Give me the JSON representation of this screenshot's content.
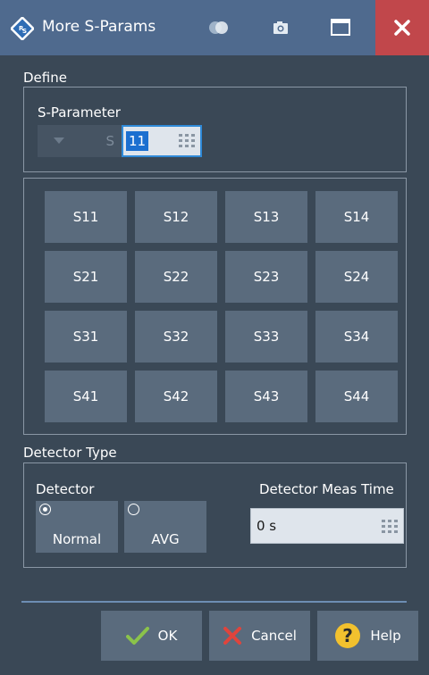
{
  "window": {
    "title": "More S-Params"
  },
  "define": {
    "section_label": "Define",
    "sparam_label": "S-Parameter",
    "prefix": "S",
    "index_value": "11"
  },
  "sparams": {
    "rows": [
      [
        "S11",
        "S12",
        "S13",
        "S14"
      ],
      [
        "S21",
        "S22",
        "S23",
        "S24"
      ],
      [
        "S31",
        "S32",
        "S33",
        "S34"
      ],
      [
        "S41",
        "S42",
        "S43",
        "S44"
      ]
    ]
  },
  "detector_type": {
    "section_label": "Detector Type",
    "detector_label": "Detector",
    "options": [
      {
        "label": "Normal",
        "selected": true
      },
      {
        "label": "AVG",
        "selected": false
      }
    ],
    "meas_time_label": "Detector Meas Time",
    "meas_time_value": "0 s"
  },
  "actions": {
    "ok": "OK",
    "cancel": "Cancel",
    "help": "Help"
  },
  "colors": {
    "titlebar": "#4f6a8e",
    "close": "#c1474b",
    "button": "#5a6b7d",
    "ok_check": "#8bc34a",
    "cancel_x": "#e0443c",
    "help_circle": "#f2c12e"
  }
}
